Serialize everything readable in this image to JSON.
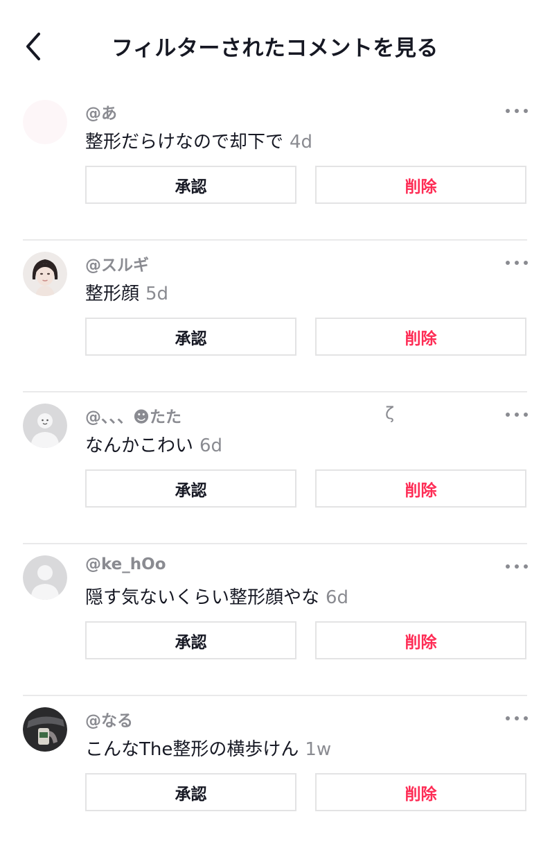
{
  "header": {
    "title": "フィルターされたコメントを見る",
    "back_icon": "chevron-left-icon"
  },
  "colors": {
    "text": "#161823",
    "secondary_text": "#8a8b91",
    "delete_red": "#fe2c55",
    "border": "#e3e3e4"
  },
  "comments": [
    {
      "username": "@あ",
      "extra": "",
      "text": "整形だらけなので却下で",
      "time": "4d",
      "approve_label": "承認",
      "delete_label": "削除",
      "avatar": "blank-avatar"
    },
    {
      "username": "@スルギ",
      "extra": "",
      "text": "整形顔",
      "time": "5d",
      "approve_label": "承認",
      "delete_label": "削除",
      "avatar": "photo-avatar-woman"
    },
    {
      "username": "@、、、☻たた",
      "extra": "ζ",
      "text": "なんかこわい",
      "time": "6d",
      "approve_label": "承認",
      "delete_label": "削除",
      "avatar": "default-avatar-face"
    },
    {
      "username": "@ke_hOo",
      "extra": "",
      "text": "隠す気ないくらい整形顔やな",
      "time": "6d",
      "approve_label": "承認",
      "delete_label": "削除",
      "avatar": "default-avatar"
    },
    {
      "username": "@なる",
      "extra": "",
      "text": "こんなThe整形の横歩けん",
      "time": "1w",
      "approve_label": "承認",
      "delete_label": "削除",
      "avatar": "photo-avatar-dark"
    }
  ]
}
